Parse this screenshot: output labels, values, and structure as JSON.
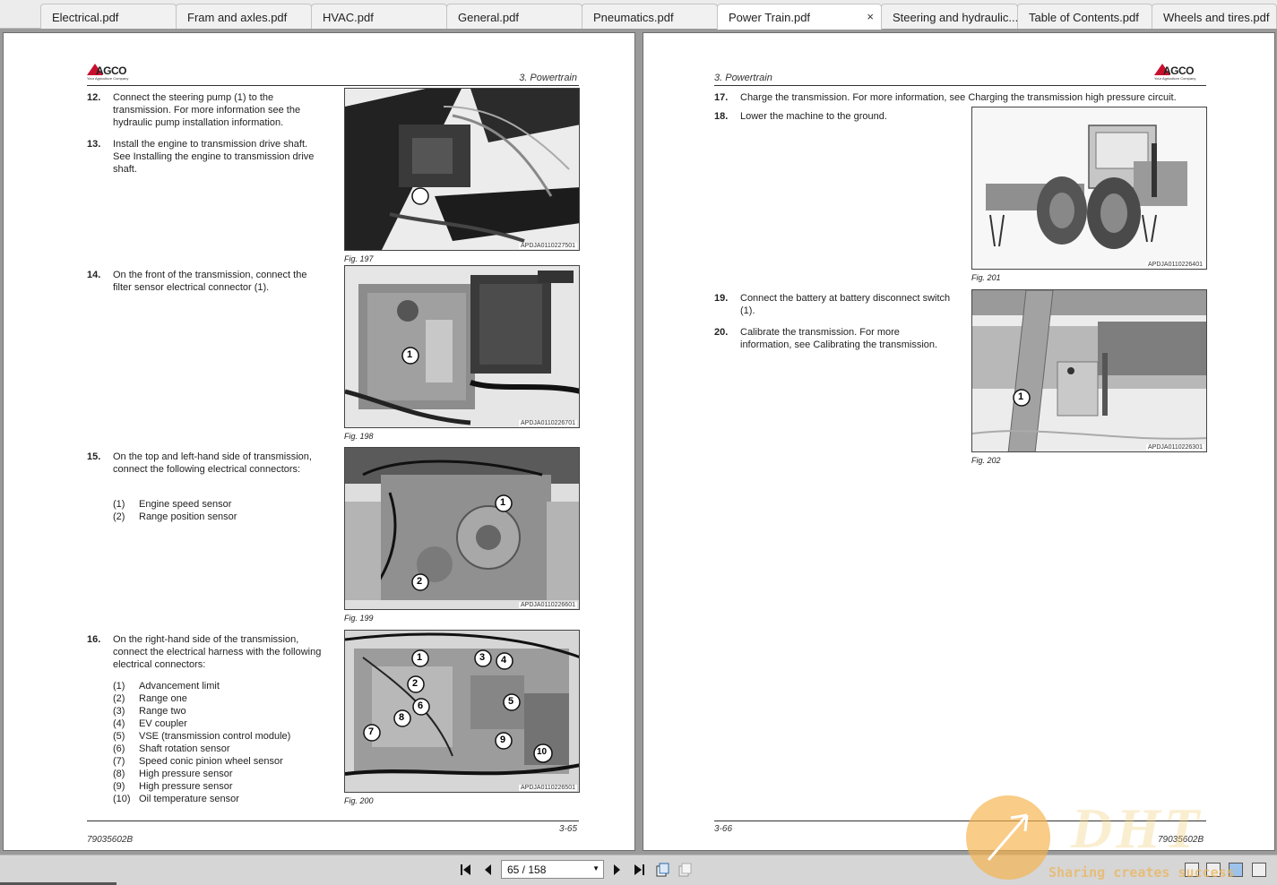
{
  "tabs": [
    {
      "label": "Electrical.pdf"
    },
    {
      "label": "Fram and axles.pdf"
    },
    {
      "label": "HVAC.pdf"
    },
    {
      "label": "General.pdf"
    },
    {
      "label": "Pneumatics.pdf"
    },
    {
      "label": "Power Train.pdf",
      "active": true
    },
    {
      "label": "Steering and hydraulic..."
    },
    {
      "label": "Table of Contents.pdf"
    },
    {
      "label": "Wheels and tires.pdf"
    }
  ],
  "tab_close_glyph": "×",
  "logo": {
    "word": "AGCO",
    "tagline": "Your Agriculture Company"
  },
  "left_page": {
    "section_title": "3. Powertrain",
    "steps": [
      {
        "num": "12.",
        "text": "Connect the steering pump (1) to the transmission. For more information see the hydraulic pump installation information."
      },
      {
        "num": "13.",
        "text": "Install the engine to transmission drive shaft. See Installing the engine to transmission drive shaft."
      },
      {
        "num": "14.",
        "text": "On the front of the transmission, connect the filter sensor electrical connector (1)."
      },
      {
        "num": "15.",
        "text": "On the top and left-hand side of transmission, connect the following electrical connectors:"
      },
      {
        "num": "16.",
        "text": "On the right-hand side of the transmission, connect the electrical harness with the following electrical connectors:"
      }
    ],
    "list15": [
      {
        "k": "(1)",
        "v": "Engine speed sensor"
      },
      {
        "k": "(2)",
        "v": "Range position sensor"
      }
    ],
    "list16": [
      {
        "k": "(1)",
        "v": "Advancement limit"
      },
      {
        "k": "(2)",
        "v": "Range one"
      },
      {
        "k": "(3)",
        "v": "Range two"
      },
      {
        "k": "(4)",
        "v": "EV coupler"
      },
      {
        "k": "(5)",
        "v": "VSE (transmission control module)"
      },
      {
        "k": "(6)",
        "v": "Shaft rotation sensor"
      },
      {
        "k": "(7)",
        "v": "Speed conic pinion wheel sensor"
      },
      {
        "k": "(8)",
        "v": "High pressure sensor"
      },
      {
        "k": "(9)",
        "v": "High pressure sensor"
      },
      {
        "k": "(10)",
        "v": "Oil temperature sensor"
      }
    ],
    "figures": [
      {
        "caption": "Fig. 197",
        "code": "APDJA0110227501"
      },
      {
        "caption": "Fig. 198",
        "code": "APDJA0110226701"
      },
      {
        "caption": "Fig. 199",
        "code": "APDJA0110226601"
      },
      {
        "caption": "Fig. 200",
        "code": "APDJA0110226501"
      }
    ],
    "page_number": "3-65",
    "doc_id": "79035602B"
  },
  "right_page": {
    "section_title": "3. Powertrain",
    "steps": [
      {
        "num": "17.",
        "text": "Charge the transmission. For more information, see Charging the transmission high pressure circuit."
      },
      {
        "num": "18.",
        "text": "Lower the machine to the ground."
      },
      {
        "num": "19.",
        "text": "Connect the battery at battery disconnect switch (1)."
      },
      {
        "num": "20.",
        "text": "Calibrate the transmission. For more information, see Calibrating the transmission."
      }
    ],
    "figures": [
      {
        "caption": "Fig. 201",
        "code": "APDJA0110226401"
      },
      {
        "caption": "Fig. 202",
        "code": "APDJA0110226301"
      }
    ],
    "page_number": "3-66",
    "doc_id": "79035602B"
  },
  "callouts": {
    "fig197": [
      "1"
    ],
    "fig198": [
      "1"
    ],
    "fig199": [
      "1",
      "2"
    ],
    "fig200": [
      "1",
      "2",
      "3",
      "4",
      "5",
      "6",
      "7",
      "8",
      "9",
      "10"
    ],
    "fig202": [
      "1"
    ]
  },
  "toolbar": {
    "page_indicator": "65 / 158",
    "first_icon": "first-page-icon",
    "prev_icon": "previous-page-icon",
    "next_icon": "next-page-icon",
    "last_icon": "last-page-icon"
  },
  "watermark": {
    "text": "DHT",
    "tagline": "Sharing creates success"
  },
  "colors": {
    "logo_red": "#c8102e",
    "watermark_orange": "#f6b046"
  }
}
